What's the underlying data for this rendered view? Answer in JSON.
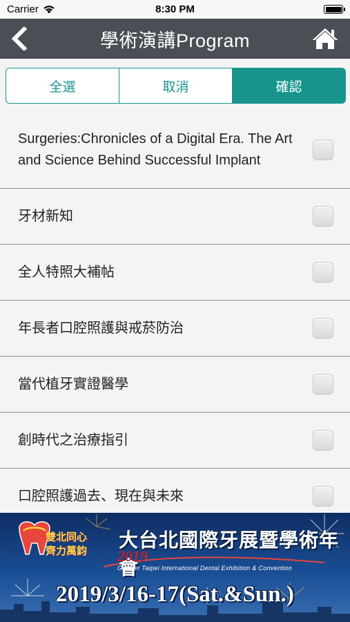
{
  "status_bar": {
    "carrier": "Carrier",
    "time": "8:30 PM"
  },
  "nav": {
    "title": "學術演講Program"
  },
  "segments": {
    "select_all": "全選",
    "cancel": "取消",
    "confirm": "確認"
  },
  "items": [
    {
      "label": "Surgeries:Chronicles of a Digital Era. The Art and Science Behind Successful Implant",
      "checked": false
    },
    {
      "label": "牙材新知",
      "checked": false
    },
    {
      "label": "全人特照大補帖",
      "checked": false
    },
    {
      "label": "年長者口腔照護與戒菸防治",
      "checked": false
    },
    {
      "label": "當代植牙實證醫學",
      "checked": false
    },
    {
      "label": "創時代之治療指引",
      "checked": false
    },
    {
      "label": "口腔照護過去、現在與未來",
      "checked": false
    }
  ],
  "banner": {
    "slogan_line1": "雙北同心",
    "slogan_line2": "齊力萬鈞",
    "title": "大台北國際牙展暨學術年會",
    "year": "2019",
    "subtitle": "Greater Taipei International Dental Exhibition & Convention",
    "date": "2019/3/16-17(Sat.&Sun.)"
  },
  "colors": {
    "accent": "#17958d",
    "nav_bg": "#4a4f56",
    "list_bg": "#f4f4f4"
  }
}
